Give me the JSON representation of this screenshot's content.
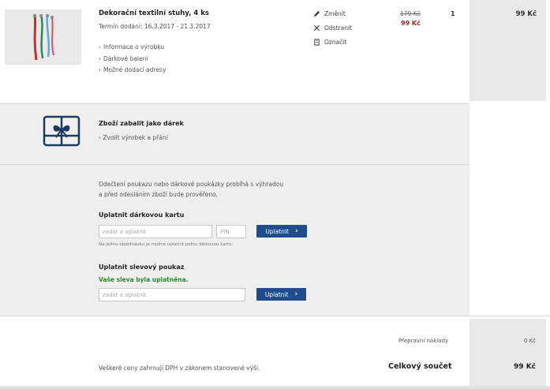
{
  "product": {
    "name": "Dekorační textilní stuhy, 4 ks",
    "delivery": "Termín dodání: 16.3.2017 - 21.3.2017",
    "links": [
      "Informace o výrobku",
      "Dárkové balení",
      "Možné dodací adresy"
    ],
    "actions": [
      {
        "label": "Změnit",
        "icon": "pencil-icon"
      },
      {
        "label": "Odstranit",
        "icon": "close-icon"
      },
      {
        "label": "Označit",
        "icon": "bookmark-icon"
      }
    ],
    "old_price": "179 Kč",
    "price": "99 Kč",
    "quantity": "1",
    "line_total": "99 Kč"
  },
  "gift": {
    "title": "Zboží zabalit jako dárek",
    "link": "Zvolit výrobek a přání",
    "icon": "gift-icon"
  },
  "voucher": {
    "note": "Odečtení poukazu nebo dárkové poukázky probíhá s výhradou a před odesláním zboží bude prověřeno.",
    "gift_card": {
      "heading": "Uplatnit dárkovou kartu",
      "code_placeholder": "zadat a uplatnit",
      "pin_placeholder": "PIN",
      "button": "Uplatnit",
      "fine_print": "Na jednu objednávku je možné uplatnit jednu dárkovou kartu."
    },
    "discount": {
      "heading": "Uplatnit slevový poukaz",
      "success": "Vaše sleva byla uplatněna.",
      "placeholder": "zadat a uplatnit",
      "button": "Uplatnit"
    }
  },
  "totals": {
    "shipping_label": "Přepravní náklady",
    "shipping_value": "0 Kč",
    "vat_note": "Veškeré ceny zahrnují DPH v zákonem stanovené výši.",
    "total_label": "Celkový součet",
    "total_value": "99 Kč"
  },
  "colors": {
    "button": "#1e4d8c",
    "sale_price": "#b22222",
    "success": "#2a8a2a",
    "gift_icon": "#1e3a5f"
  }
}
